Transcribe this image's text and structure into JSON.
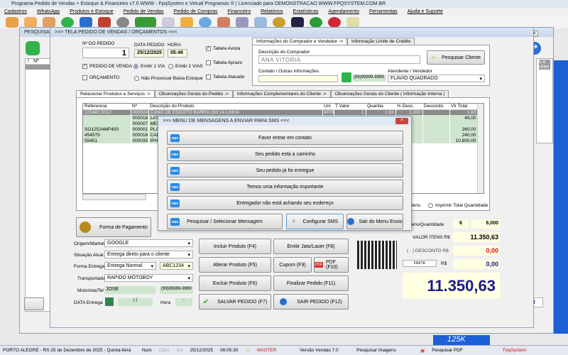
{
  "app": {
    "title": "Programa Pedido de Vendas + Estoque & Financeiro v7.0 WWW - FpqSystem e Virtual Programas ® | Licenciado para  DEMONSTRACAO WWW.FPQSYSTEM.COM.BR"
  },
  "menu": [
    "Cadastros",
    "WhatsApp",
    "Produtos e Estoque",
    "Pedido de Vendas",
    "Pedido de Compras",
    "Financeiro",
    "Relatórios",
    "Estatísticas",
    "Agendamento",
    "Ferramentas",
    "Ajuda e Suporte"
  ],
  "toolbar": {
    "first_label": "Clien"
  },
  "search_window": {
    "title": "PESQUISA DOS",
    "list_headers": [
      "!",
      "Nº"
    ],
    "right_text": "s o clien",
    "total_value": ".350,63"
  },
  "order": {
    "title": ">>>  TELA PEDIDO DE VENDAS / ORÇAMENTOS  <<<",
    "order_no_label": "Nº DO PEDIDO",
    "order_no": "1",
    "date_label": "DATA PEDIDO",
    "date": "25/12/2025",
    "time_label": "HORA",
    "time": "05:48",
    "chk_pedido": "PEDIDO DE VENDA",
    "chk_orcamento": "ORÇAMENTO",
    "radio_1via": "Emitir 1 VIA",
    "radio_2vias": "Emitir 2 VIAS",
    "radio_nao_proc": "Não Processar Baixa Estoque",
    "tabela_avista": "Tabela Avista",
    "tabela_aprazo": "Tabela Aprazo",
    "tabela_atacado": "Tabela Atacado",
    "buyer_tabs": [
      "Informações do Comprador e Vendedor ->",
      "Informação Limite de Crédito"
    ],
    "buyer_label": "Descrição do Comprador",
    "buyer": "ANA VITORIA",
    "search_client": "Pesquisar Cliente",
    "contact_label": "Contato / Outras Informações",
    "contact": "",
    "phone": "(99)99999-9999",
    "seller_label": "Atendente / Vendedor",
    "seller": "FLAVIO QUADRADO",
    "tabs": [
      "Relacionar Produtos e Serviços ->",
      "Observações Gerais do Pedido ->",
      "Informações Complementares do Cliente ->",
      "Observações Gerais do Cliente ( Informação Interna )"
    ],
    "columns": [
      "Referencia",
      "Nº",
      "Descrição do Produto",
      "Uni",
      "T Valor",
      "Quantia",
      "% Desc.",
      "Desconto",
      "Vlr Total"
    ],
    "rows": [
      {
        "ref": "125482.5512",
        "no": "000024",
        "desc": "CANO DE ESGOTO BARRA 150 24 LINHA",
        "uni": "MTR",
        "t": "1",
        "valor": "1,63",
        "qtd": "1,000",
        "pdesc": "",
        "desc_v": "",
        "total": "1,63"
      },
      {
        "ref": "",
        "no": "000018",
        "desc": "LATA",
        "total": "49,00"
      },
      {
        "ref": "",
        "no": "000007",
        "desc": "MEM",
        "total": ""
      },
      {
        "ref": "SO12524MP400",
        "no": "000001",
        "desc": "PLAI",
        "total": "260,00"
      },
      {
        "ref": "454575",
        "no": "000016",
        "desc": "CAD",
        "total": "240,00"
      },
      {
        "ref": "55451",
        "no": "000035",
        "desc": "IPHO",
        "total": "10.800,00"
      }
    ],
    "print_items": "Itens",
    "print_total_qty": "Imprimir Total Quantidade",
    "payment": "Forma de Pagamento",
    "origem_label": "Origem/Market",
    "origem": "GOOGLE",
    "situacao_label": "Situação Atual",
    "situacao": "Entrega direto para o cliente",
    "entrega_label": "Forma Entrega",
    "entrega": "Entrega Normal",
    "placa": "ABC1234",
    "transp_label": "Transportador",
    "transp": "RAPIDO MOTOBOY",
    "motorista_label": "Motorista/Tel",
    "motorista": "JOSE",
    "motorista_tel": "(99)99999-9999",
    "data_entrega_label": "DATA Entrega",
    "data_entrega": "/  /",
    "hora_label": "Hora",
    "hora": ":",
    "actions": {
      "incluir": "Incluir Produto  (F4)",
      "alterar": "Alterar Produto  (F5)",
      "excluir": "Excluir Produto  (F6)",
      "salvar": "SALVAR PEDIDO (F7)",
      "emitir": "Emitir Jato/Laser (F8)",
      "cupom": "Cupom (F9)",
      "pdf": "PDF (F10)",
      "finalizar": "Finalizar Pedido  (F11)",
      "sair": "SAIR  PEDIDO  (F12)"
    },
    "totals": {
      "itens_label": "Itens/Quantidade",
      "itens": "6",
      "qtd": "6,000",
      "valor_label": "VALOR ITENS R$",
      "valor": "11.350,63",
      "desconto_label": "( - ) DESCONTO R$",
      "desconto": "0,00",
      "frete_label": "FRETE",
      "frete_rs": "R$",
      "frete": "0,00",
      "total": "11.350,63"
    }
  },
  "sms": {
    "title": ">>> MENU DE MENSAGENS A ENVIAR PARA SMS <<<",
    "messages": [
      "Favor entrar em contato",
      "Seu pedido está a caminho",
      "Seu pedido já foi entregue",
      "Temos uma informação importante",
      "Entregador não está achando seu endereço"
    ],
    "search": "Pesquisar / Selecionar Mensagem",
    "config": "Configurar SMS",
    "exit": "Sair do Menu Envio"
  },
  "badge": "125K",
  "status": {
    "location": "PORTO ALEGRE - RS 25 de Dezembro de 2025 - Quinta-feira",
    "num": "Num",
    "caps": "Caps",
    "ins": "Ins",
    "date": "25/12/2025",
    "time": "06:05:30",
    "user": "MASTER",
    "version": "Versão Vendas 7.0",
    "images": "Pesquisar Imagens",
    "pdf": "Pesquisar PDF",
    "brand": "FpqSystem"
  },
  "colors": {
    "accent_blue": "#1c5fd6",
    "total_text": "#1a1a8c",
    "discount": "#e01010",
    "grid_green": "#cfe5cf"
  }
}
